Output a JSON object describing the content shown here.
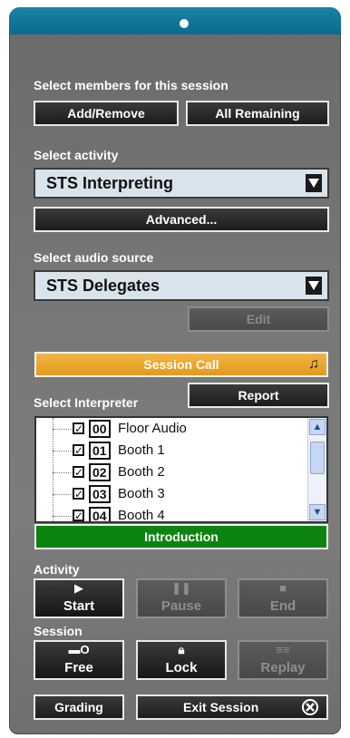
{
  "members": {
    "label": "Select members for this session",
    "add_remove": "Add/Remove",
    "all_remaining": "All Remaining"
  },
  "activity_select": {
    "label": "Select activity",
    "value": "STS Interpreting",
    "advanced": "Advanced..."
  },
  "audio_source": {
    "label": "Select audio source",
    "value": "STS Delegates",
    "edit": "Edit"
  },
  "session_call": "Session Call",
  "interpreter": {
    "label": "Select Interpreter",
    "report": "Report",
    "items": [
      {
        "code": "00",
        "name": "Floor Audio",
        "checked": true
      },
      {
        "code": "01",
        "name": "Booth 1",
        "checked": true
      },
      {
        "code": "02",
        "name": "Booth 2",
        "checked": true
      },
      {
        "code": "03",
        "name": "Booth 3",
        "checked": true
      },
      {
        "code": "04",
        "name": "Booth 4",
        "checked": true
      }
    ],
    "introduction": "Introduction"
  },
  "activity": {
    "label": "Activity",
    "start": "Start",
    "pause": "Pause",
    "end": "End"
  },
  "session": {
    "label": "Session",
    "free": "Free",
    "lock": "Lock",
    "replay": "Replay"
  },
  "footer": {
    "grading": "Grading",
    "exit": "Exit Session"
  },
  "colors": {
    "titlebar": "#0a6a8e",
    "session_call": "#e39a1c",
    "introduction": "#0e8410",
    "panel": "#777777"
  },
  "icons": [
    "play-icon",
    "pause-icon",
    "stop-icon",
    "key-icon",
    "lock-icon",
    "replay-icon",
    "close-circle-icon",
    "music-note-icon",
    "dropdown-arrow-icon",
    "scroll-up-icon",
    "scroll-down-icon"
  ]
}
